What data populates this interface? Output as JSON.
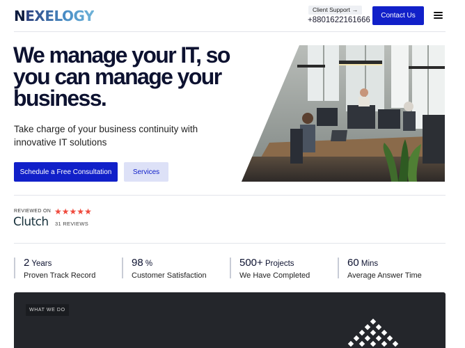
{
  "header": {
    "logo_first": "N",
    "logo_rest": "EXELOGY",
    "support_label": "Client Support",
    "support_arrow": "→",
    "phone": "+8801622161666",
    "contact_label": "Contact Us"
  },
  "hero": {
    "title": "We manage your IT, so you can manage your business.",
    "subtitle": "Take charge of your business continuity with innovative IT solutions",
    "primary_cta": "Schedule a Free Consultation",
    "secondary_cta": "Services"
  },
  "clutch": {
    "reviewed_on": "REVIEWED ON",
    "logo_text": "Clutch",
    "rating_stars": 5,
    "reviews": "31 REVIEWS"
  },
  "stats": [
    {
      "value": "2",
      "unit": " Years",
      "label": "Proven Track Record"
    },
    {
      "value": "98",
      "unit": " %",
      "label": "Customer Satisfaction"
    },
    {
      "value": "500+",
      "unit": " Projects",
      "label": "We Have Completed"
    },
    {
      "value": "60",
      "unit": " Mins",
      "label": "Average Answer Time"
    }
  ],
  "what_we_do": {
    "tag": "WHAT WE DO"
  },
  "colors": {
    "primary": "#1120c9",
    "secondary_bg": "#dde1f7",
    "star": "#ef4a3d",
    "dark_panel": "#24262b"
  }
}
